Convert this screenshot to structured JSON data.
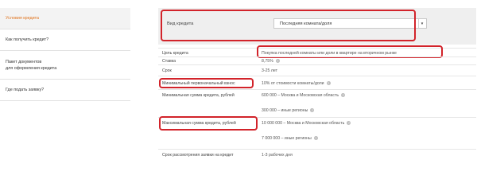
{
  "sidebar": {
    "items": [
      {
        "label": "Условия кредита",
        "active": true
      },
      {
        "label": "Как получить кредит?"
      },
      {
        "label_line1": "Пакет документов",
        "label_line2": "для оформления кредита"
      },
      {
        "label": "Где подать заявку?"
      }
    ]
  },
  "loan_type": {
    "label": "Вид кредита",
    "selected": "Последняя комната/доля"
  },
  "rows": {
    "purpose": {
      "label": "Цель кредита",
      "value": "Покупка последней комнаты или доли в квартире на вторичном рынке"
    },
    "rate": {
      "label": "Ставка",
      "value": "8,75%"
    },
    "term": {
      "label": "Срок",
      "value": "3-25 лет"
    },
    "down_payment": {
      "label": "Минимальный первоначальный взнос",
      "value": "10% от стоимости комнаты/доли"
    },
    "min_amount": {
      "label": "Минимальная сумма кредита, рублей",
      "value_1": "600 000 – Москва и Московская область",
      "value_2": "300 000 – иные регионы"
    },
    "max_amount": {
      "label": "Максимальная сумма кредита, рублей",
      "value_1": "10 000 000 – Москва и Московская область",
      "value_2": "7 000 000 – иные регионы"
    },
    "review": {
      "label": "Срок рассмотрения заявки на кредит",
      "value": "1-3 рабочих дня"
    }
  },
  "colors": {
    "accent": "#e1731c",
    "highlight_box": "#d2232a"
  }
}
